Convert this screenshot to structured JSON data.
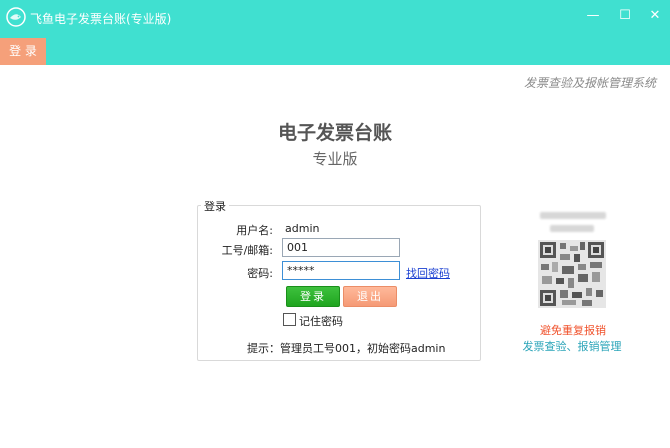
{
  "window": {
    "title": "飞鱼电子发票台账(专业版)",
    "logo_icon": "fish-logo-icon",
    "minimize_glyph": "—",
    "maximize_glyph": "☐",
    "close_glyph": "✕"
  },
  "menu": {
    "login_label": "登 录"
  },
  "slogan": "发票查验及报帐管理系统",
  "header": {
    "title": "电子发票台账",
    "subtitle": "专业版"
  },
  "login": {
    "group_title": "登录",
    "username_label": "用户名:",
    "username_value": "admin",
    "staff_label": "工号/邮箱:",
    "staff_value": "001",
    "password_label": "密码:",
    "password_value": "*****",
    "forgot_link": "找回密码",
    "login_button": "登录",
    "exit_button": "退出",
    "remember_label": "记住密码",
    "remember_checked": false,
    "hint": "提示：管理员工号001，初始密码admin"
  },
  "promo": {
    "warning": "避免重复报销",
    "description": "发票查验、报销管理"
  },
  "colors": {
    "titlebar": "#40e0d0",
    "menu_active": "#f5a07a",
    "login_button": "#2bb52b",
    "exit_button": "#f7a889",
    "warning_text": "#f0522c",
    "desc_text": "#2aa4b8"
  }
}
